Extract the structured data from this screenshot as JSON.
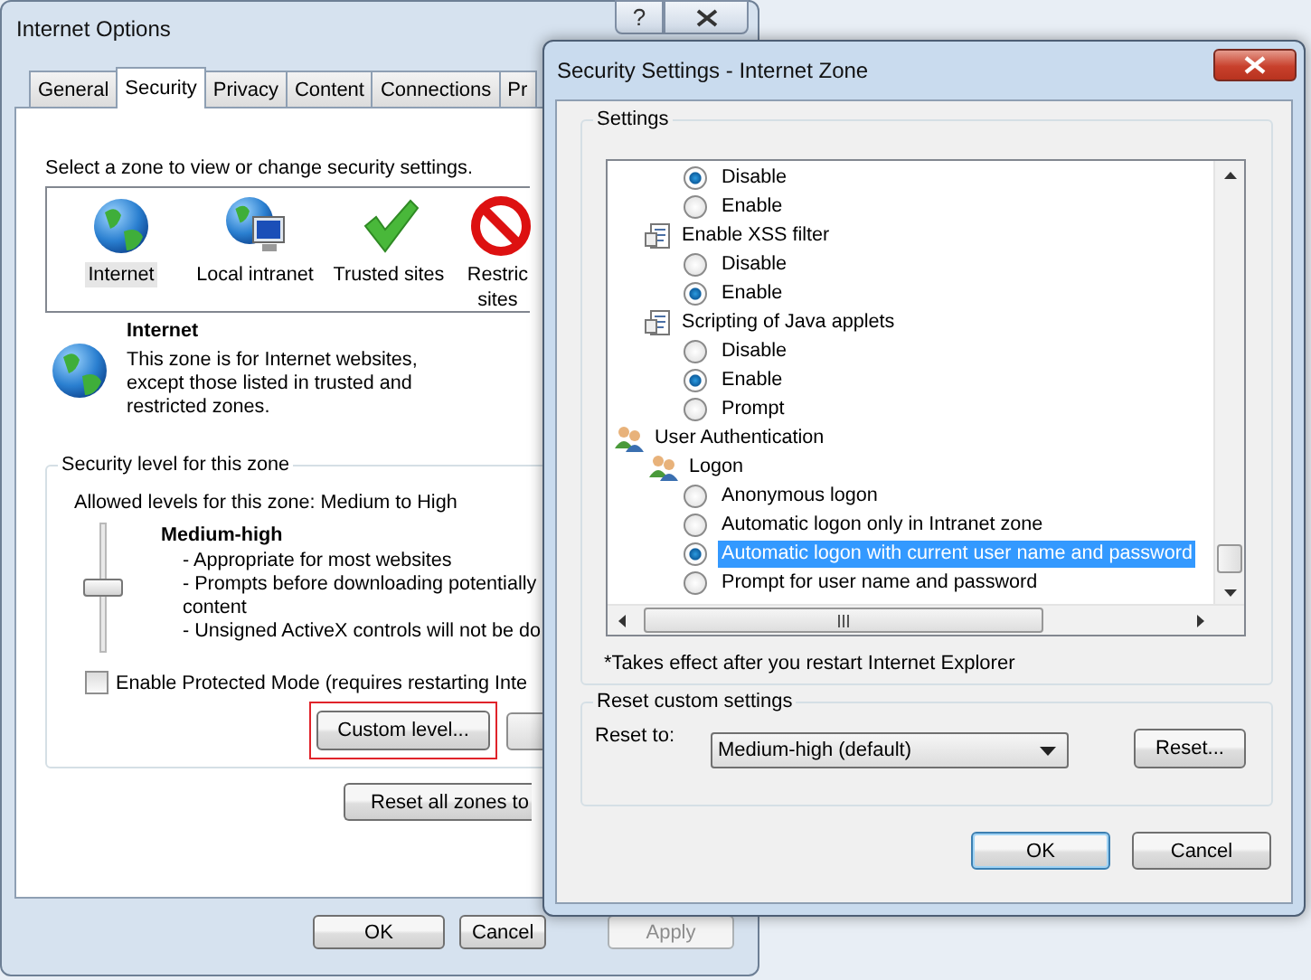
{
  "back_window": {
    "title": "Internet Options",
    "help_button": "?",
    "tabs": [
      {
        "label": "General",
        "selected": false
      },
      {
        "label": "Security",
        "selected": true
      },
      {
        "label": "Privacy",
        "selected": false
      },
      {
        "label": "Content",
        "selected": false
      },
      {
        "label": "Connections",
        "selected": false
      },
      {
        "label": "Pr",
        "selected": false
      }
    ],
    "zone_prompt": "Select a zone to view or change security settings.",
    "zones": [
      {
        "kind": "globe",
        "lines": [
          "Internet"
        ],
        "selected": true
      },
      {
        "kind": "intranet",
        "lines": [
          "Local intranet"
        ],
        "selected": false
      },
      {
        "kind": "check",
        "lines": [
          "Trusted sites"
        ],
        "selected": false
      },
      {
        "kind": "blocked",
        "lines": [
          "Restric",
          "sites"
        ],
        "selected": false
      }
    ],
    "zone_info": {
      "name": "Internet",
      "description": "This zone is for Internet websites, except those listed in trusted and restricted zones."
    },
    "security_level": {
      "title": "Security level for this zone",
      "allowed": "Allowed levels for this zone: Medium to High",
      "level": 0.5,
      "level_name": "Medium-high",
      "lines": [
        "- Appropriate for most websites",
        "- Prompts before downloading potentially",
        "content",
        "- Unsigned ActiveX controls will not be do"
      ]
    },
    "protected_mode": {
      "label": "Enable Protected Mode (requires restarting Inte",
      "checked": false
    },
    "custom_level_button": {
      "label": "Custom level...",
      "highlighted": true
    },
    "reset_all_button": "Reset all zones to",
    "buttons": [
      {
        "label": "OK",
        "disabled": false
      },
      {
        "label": "Cancel",
        "disabled": false
      },
      {
        "label": "Apply",
        "disabled": true
      }
    ]
  },
  "front_window": {
    "title": "Security Settings - Internet Zone",
    "settings_label": "Settings",
    "tree": [
      {
        "kind": "option",
        "label": "Disable",
        "checked": true,
        "selected": false
      },
      {
        "kind": "option",
        "label": "Enable",
        "checked": false,
        "selected": false
      },
      {
        "kind": "setting",
        "label": "Enable XSS filter",
        "children": [
          {
            "kind": "option",
            "label": "Disable",
            "checked": false,
            "selected": false
          },
          {
            "kind": "option",
            "label": "Enable",
            "checked": true,
            "selected": false
          }
        ]
      },
      {
        "kind": "setting",
        "label": "Scripting of Java applets",
        "children": [
          {
            "kind": "option",
            "label": "Disable",
            "checked": false,
            "selected": false
          },
          {
            "kind": "option",
            "label": "Enable",
            "checked": true,
            "selected": false
          },
          {
            "kind": "option",
            "label": "Prompt",
            "checked": false,
            "selected": false
          }
        ]
      },
      {
        "kind": "category",
        "label": "User Authentication",
        "children": [
          {
            "kind": "user-setting",
            "label": "Logon",
            "children": [
              {
                "kind": "option",
                "label": "Anonymous logon",
                "checked": false,
                "selected": false
              },
              {
                "kind": "option",
                "label": "Automatic logon only in Intranet zone",
                "checked": false,
                "selected": false
              },
              {
                "kind": "option",
                "label": "Automatic logon with current user name and password",
                "checked": true,
                "selected": true
              },
              {
                "kind": "option",
                "label": "Prompt for user name and password",
                "checked": false,
                "selected": false
              }
            ]
          }
        ]
      }
    ],
    "note": "*Takes effect after you restart Internet Explorer",
    "reset": {
      "title": "Reset custom settings",
      "label": "Reset to:",
      "value": "Medium-high (default)",
      "button": "Reset..."
    },
    "buttons": [
      {
        "label": "OK",
        "default": true
      },
      {
        "label": "Cancel",
        "default": false
      }
    ]
  }
}
